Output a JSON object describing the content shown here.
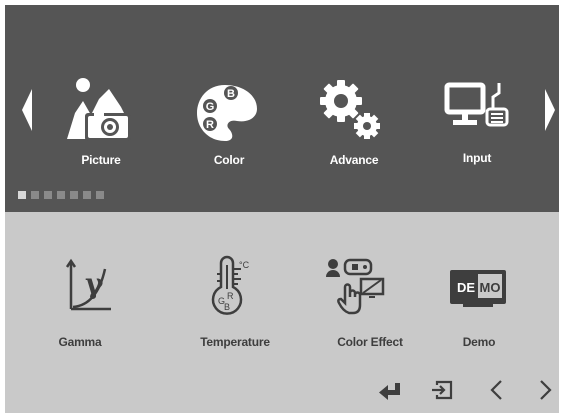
{
  "menu": {
    "items": [
      {
        "label": "Picture",
        "icon": "picture-icon"
      },
      {
        "label": "Color",
        "icon": "color-palette-icon"
      },
      {
        "label": "Advance",
        "icon": "gears-icon"
      },
      {
        "label": "Input",
        "icon": "input-pc-icon"
      }
    ],
    "palette_letters": {
      "g": "G",
      "b": "B",
      "r": "R"
    },
    "page_dots_total": 7,
    "page_dots_active": 1
  },
  "submenu": {
    "items": [
      {
        "label": "Gamma",
        "icon": "gamma-icon",
        "symbol": "γ"
      },
      {
        "label": "Temperature",
        "icon": "thermometer-icon",
        "unit": "°C",
        "g": "G",
        "r": "R",
        "b": "B"
      },
      {
        "label": "Color Effect",
        "icon": "color-effect-icon"
      },
      {
        "label": "Demo",
        "icon": "demo-icon",
        "text_de": "DE",
        "text_mo": "MO"
      }
    ]
  },
  "nav": {
    "buttons": [
      "enter-icon",
      "exit-icon",
      "left-icon",
      "right-icon"
    ]
  },
  "colors": {
    "top_bg": "#555555",
    "bottom_bg": "#c9c9c9",
    "top_icon": "#ffffff",
    "bottom_icon": "#3e3e3e"
  }
}
